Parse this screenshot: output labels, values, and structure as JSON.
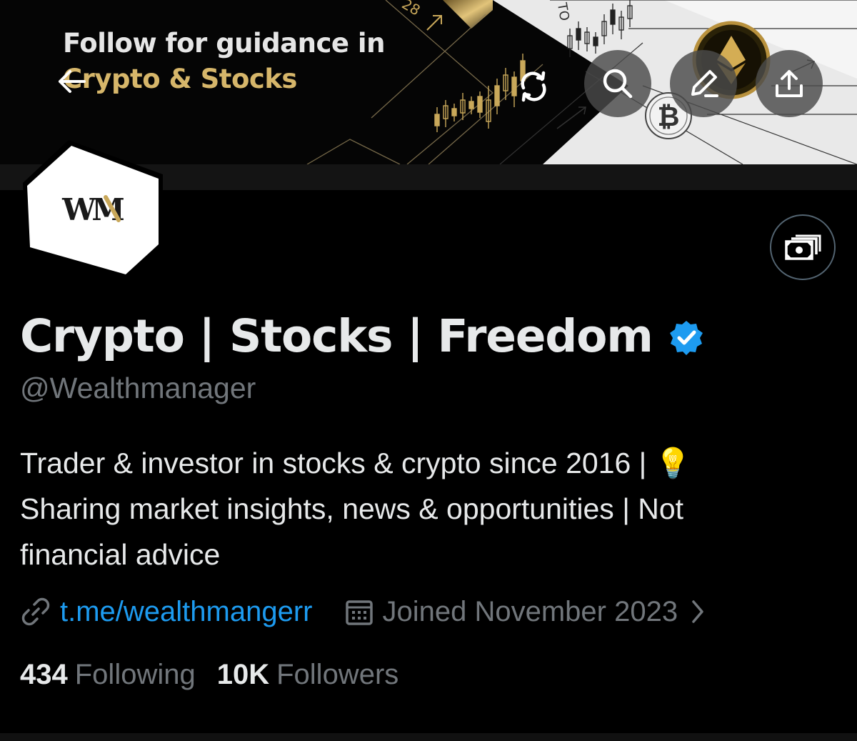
{
  "banner": {
    "line1": "Follow for guidance in",
    "line2": "Crypto & Stocks",
    "top_label_left": "28",
    "top_label_right": "TO"
  },
  "toolbar": {
    "back_icon": "arrow-left-icon",
    "refresh_icon": "refresh-icon",
    "search_icon": "search-icon",
    "edit_icon": "edit-icon",
    "share_icon": "share-icon"
  },
  "avatar": {
    "monogram": "WM"
  },
  "money_button": {
    "icon": "money-icon"
  },
  "profile": {
    "display_name": "Crypto | Stocks | Freedom",
    "handle": "@Wealthmanager",
    "bio_lines": [
      "Trader & investor in stocks & crypto since 2016 | 💡",
      "Sharing market insights, news & opportunities | Not",
      "financial advice"
    ],
    "link": "t.me/wealthmangerr",
    "joined": "Joined November 2023",
    "following_count": "434",
    "following_label": "Following",
    "followers_count": "10K",
    "followers_label": "Followers"
  },
  "colors": {
    "background": "#000000",
    "text_primary": "#e7e9ea",
    "text_secondary": "#71767b",
    "link": "#1d9bf0",
    "verified": "#1d9bf0",
    "gold": "#d6b66a"
  }
}
